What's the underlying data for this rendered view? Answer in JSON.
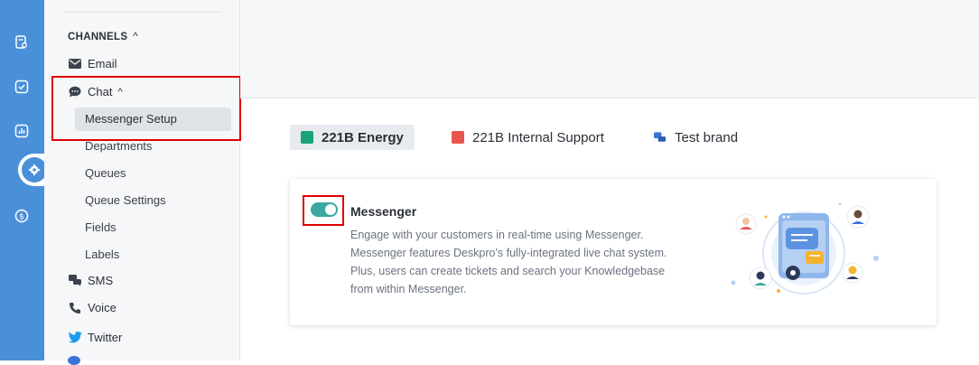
{
  "rail": {
    "icons": [
      "search-doc-icon",
      "checkbox-icon",
      "report-icon",
      "settings-icon",
      "billing-icon"
    ]
  },
  "sidebar": {
    "section_title": "CHANNELS",
    "section_chevron": "^",
    "email": "Email",
    "chat": "Chat",
    "chat_chevron": "^",
    "chat_items": [
      "Messenger Setup",
      "Departments",
      "Queues",
      "Queue Settings",
      "Fields",
      "Labels"
    ],
    "sms": "SMS",
    "voice": "Voice",
    "twitter": "Twitter"
  },
  "brands": [
    {
      "label": "221B Energy",
      "color": "#1aa37a"
    },
    {
      "label": "221B Internal Support",
      "color": "#e8554e"
    },
    {
      "label": "Test brand",
      "color": "#3b74d6"
    }
  ],
  "messenger": {
    "title": "Messenger",
    "description": "Engage with your customers in real-time using Messenger. Messenger features Deskpro's fully-integrated live chat system. Plus, users can create tickets and search your Knowledgebase from within Messenger.",
    "enabled": true
  },
  "colors": {
    "rail": "#4a90d9",
    "toggle_on": "#3aa8a0",
    "highlight": "#e00000"
  }
}
